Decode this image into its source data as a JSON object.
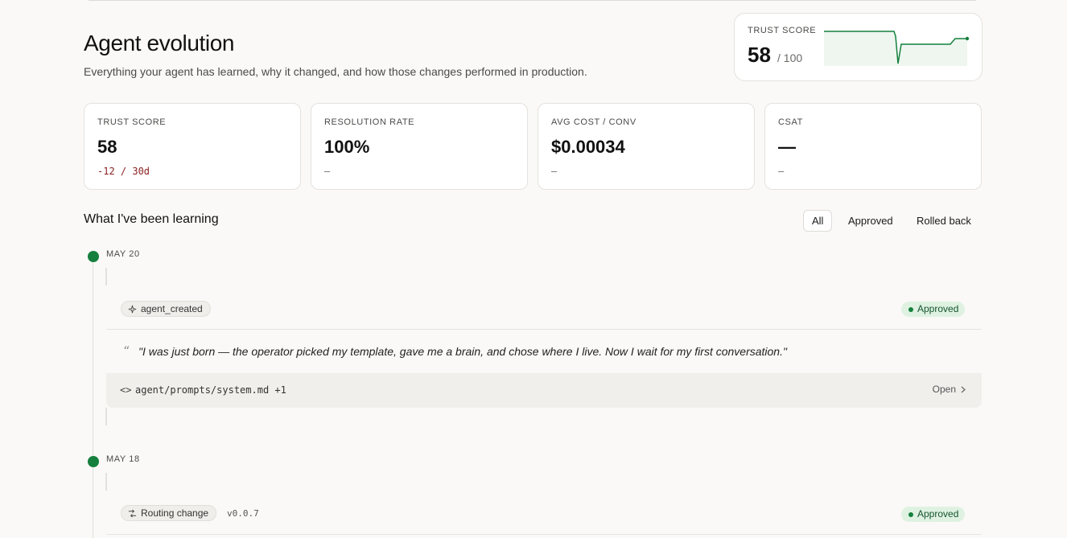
{
  "header": {
    "title": "Agent evolution",
    "subtitle": "Everything your agent has learned, why it changed, and how those changes performed in production."
  },
  "trust_card": {
    "label": "TRUST SCORE",
    "value": "58",
    "denominator": "/ 100",
    "sparkline_color": "#15803d",
    "sparkline_fill": "#eef6ef"
  },
  "kpis": [
    {
      "label": "TRUST SCORE",
      "value": "58",
      "delta": "-12 / 30d"
    },
    {
      "label": "RESOLUTION RATE",
      "value": "100%",
      "delta": "–"
    },
    {
      "label": "AVG COST / CONV",
      "value": "$0.00034",
      "delta": "–"
    },
    {
      "label": "CSAT",
      "value": "—",
      "delta": "–"
    }
  ],
  "learning": {
    "title": "What I've been learning",
    "filters": [
      "All",
      "Approved",
      "Rolled back"
    ],
    "active_filter": "All"
  },
  "timeline": [
    {
      "date": "MAY 20",
      "tag": "agent_created",
      "tag_icon": "sparkle-icon",
      "status": "Approved",
      "quote": "\"I was just born — the operator picked my template, gave me a brain, and chose where I live. Now I wait for my first conversation.\"",
      "files": "agent/prompts/system.md +1",
      "open_label": "Open"
    },
    {
      "date": "MAY 18",
      "tag": "Routing change",
      "tag_icon": "routing-icon",
      "version": "v0.0.7",
      "status": "Approved"
    }
  ],
  "colors": {
    "accent": "#15803d",
    "badge_bg": "#dff2e2",
    "negative": "#8b1f1f",
    "background": "#faf9f7"
  }
}
